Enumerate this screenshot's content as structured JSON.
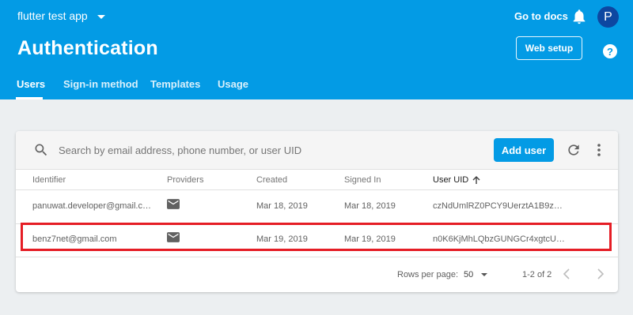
{
  "header": {
    "project_name": "flutter test app",
    "docs_link": "Go to docs",
    "avatar_initial": "P",
    "title": "Authentication",
    "web_setup_label": "Web setup",
    "help_glyph": "?",
    "tabs": [
      {
        "label": "Users",
        "active": true
      },
      {
        "label": "Sign-in method",
        "active": false
      },
      {
        "label": "Templates",
        "active": false
      },
      {
        "label": "Usage",
        "active": false
      }
    ],
    "colors": {
      "brand": "#039be5",
      "avatar": "#0d47a1"
    }
  },
  "toolbar": {
    "search_placeholder": "Search by email address, phone number, or user UID",
    "add_user_label": "Add user",
    "icons": [
      "search-icon",
      "refresh-icon",
      "more-vert-icon"
    ]
  },
  "table": {
    "columns": [
      "Identifier",
      "Providers",
      "Created",
      "Signed In",
      "User UID"
    ],
    "sorted_column": "User UID",
    "sort_direction": "ascending",
    "rows": [
      {
        "identifier": "panuwat.developer@gmail.c…",
        "provider_icon": "mail-icon",
        "created": "Mar 18, 2019",
        "signed_in": "Mar 18, 2019",
        "uid": "czNdUmlRZ0PCY9UerztA1B9zT…"
      },
      {
        "identifier": "benz7net@gmail.com",
        "provider_icon": "mail-icon",
        "created": "Mar 19, 2019",
        "signed_in": "Mar 19, 2019",
        "uid": "n0K6KjMhLQbzGUNGCr4xgtcUZ…",
        "highlighted": true
      }
    ],
    "highlight_color": "#e51d25"
  },
  "pagination": {
    "rows_per_page_label": "Rows per page:",
    "rows_per_page_value": "50",
    "range": "1-2 of 2"
  }
}
